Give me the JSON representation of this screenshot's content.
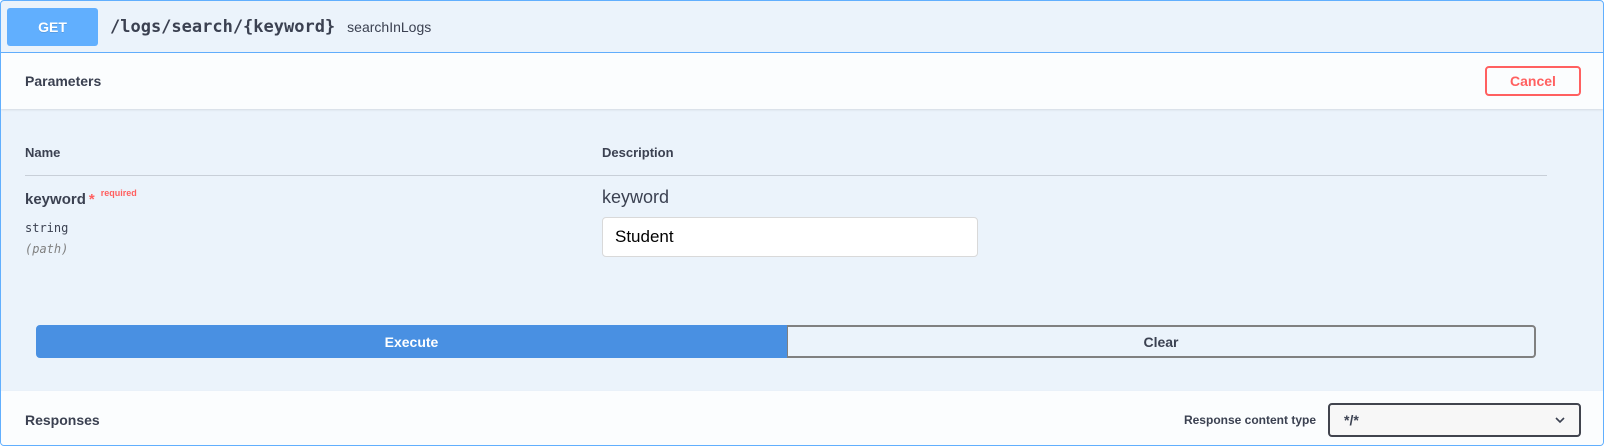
{
  "operation": {
    "method": "GET",
    "path": "/logs/search/{keyword}",
    "operation_id": "searchInLogs"
  },
  "parameters": {
    "title": "Parameters",
    "cancel_label": "Cancel",
    "col_name": "Name",
    "col_description": "Description",
    "items": [
      {
        "name": "keyword",
        "required_star": "*",
        "required_label": "required",
        "type": "string",
        "in": "(path)",
        "description": "keyword",
        "value": "Student"
      }
    ]
  },
  "actions": {
    "execute_label": "Execute",
    "clear_label": "Clear"
  },
  "responses": {
    "title": "Responses",
    "content_type_label": "Response content type",
    "content_type_value": "*/*"
  },
  "colors": {
    "get_accent": "#61affe",
    "execute": "#4990e2",
    "cancel": "#ff6060"
  }
}
